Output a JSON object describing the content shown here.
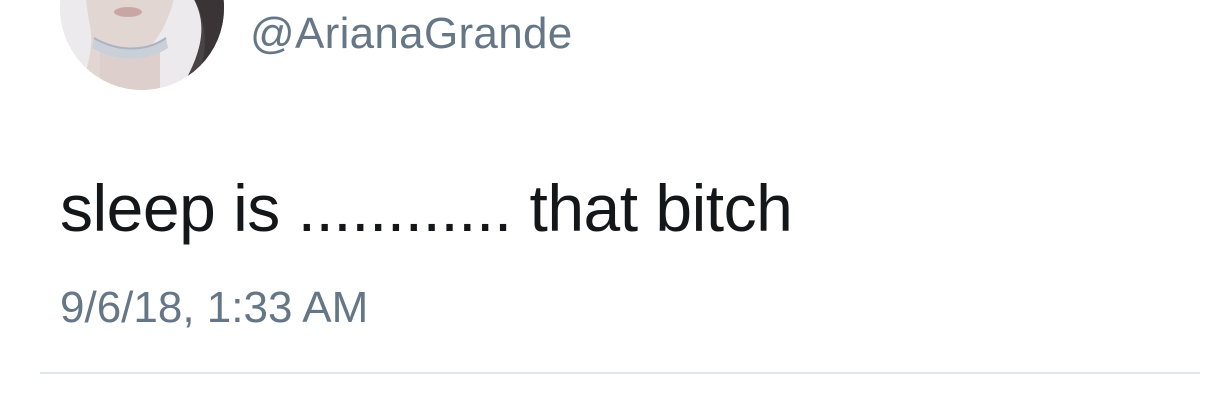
{
  "tweet": {
    "avatar_icon": "profile-photo",
    "handle": "@ArianaGrande",
    "text": "sleep is ............ that bitch",
    "timestamp": "9/6/18, 1:33 AM"
  },
  "colors": {
    "text": "#14171a",
    "secondary_text": "#657786",
    "divider": "#e1e8ed",
    "background": "#ffffff"
  }
}
